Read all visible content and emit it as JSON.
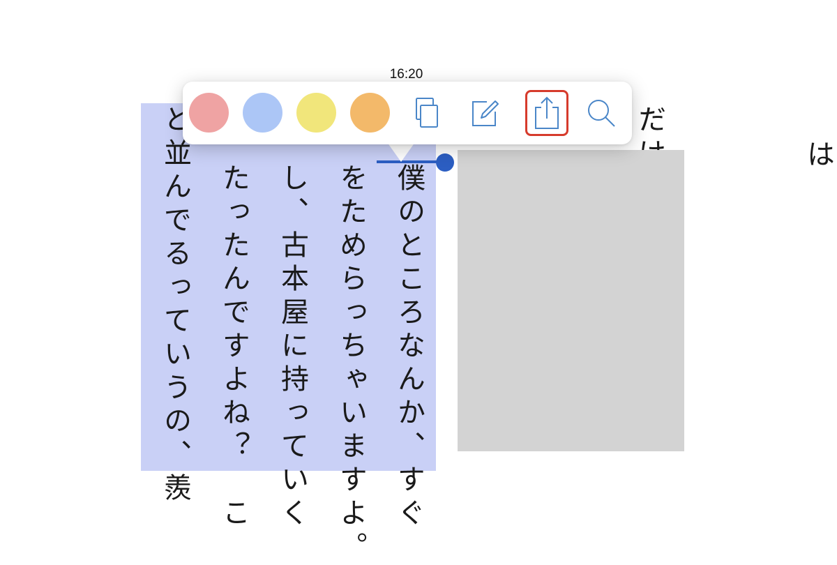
{
  "status": {
    "time": "16:20"
  },
  "reader": {
    "columns": [
      {
        "text": "僕のところなんか、すぐ",
        "top": false
      },
      {
        "text": "をためらっちゃいますよ。",
        "top": false
      },
      {
        "text": "し、古本屋に持っていく",
        "top": false
      },
      {
        "text": "たったんですよね？　こ",
        "top": false
      },
      {
        "text": "と並んでるっていうの、羨",
        "top": true
      },
      {
        "text": "だけ",
        "top": true
      },
      {
        "text": "は",
        "top": true
      }
    ]
  },
  "menu": {
    "swatches": [
      {
        "name": "highlight-red",
        "color": "#efa3a3"
      },
      {
        "name": "highlight-blue",
        "color": "#acc6f6"
      },
      {
        "name": "highlight-yellow",
        "color": "#f1e67b"
      },
      {
        "name": "highlight-orange",
        "color": "#f3b96a"
      }
    ],
    "actions": [
      {
        "name": "copy",
        "icon": "copy-icon"
      },
      {
        "name": "note",
        "icon": "note-edit-icon"
      },
      {
        "name": "share",
        "icon": "share-icon",
        "active": true
      },
      {
        "name": "search",
        "icon": "search-icon"
      }
    ],
    "icon_color": "#4a86c8",
    "active_border": "#d63b2c",
    "selection_color": "#2c5ec2",
    "highlight_color": "#c9d0f6"
  }
}
